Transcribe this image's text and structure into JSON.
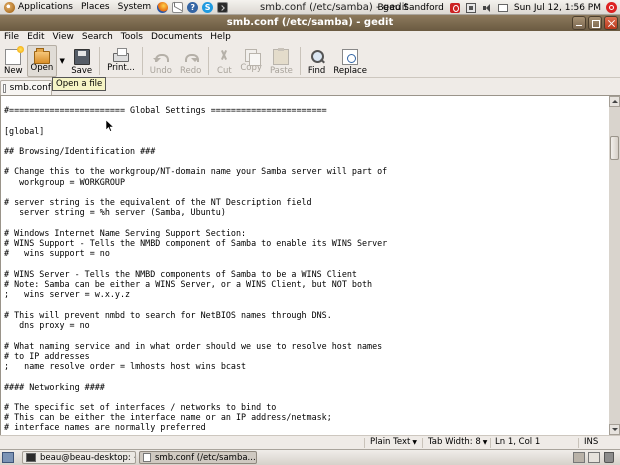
{
  "top_panel": {
    "menus": [
      "Applications",
      "Places",
      "System"
    ],
    "launchers": [
      "firefox-icon",
      "mail-icon",
      "help-icon",
      "skype-icon",
      "terminal-icon"
    ],
    "help_glyph": "?",
    "skype_glyph": "S",
    "user": "Beau Sandford",
    "clock": "Sun Jul 12,  1:56 PM",
    "tray_icons": [
      "network-icon",
      "volume-icon",
      "mail-indicator-icon"
    ]
  },
  "window": {
    "title": "smb.conf (/etc/samba) - gedit",
    "buttons": [
      "minimize",
      "maximize",
      "close"
    ]
  },
  "menubar": [
    "File",
    "Edit",
    "View",
    "Search",
    "Tools",
    "Documents",
    "Help"
  ],
  "toolbar": {
    "new": "New",
    "open": "Open",
    "save": "Save",
    "print": "Print...",
    "undo": "Undo",
    "redo": "Redo",
    "cut": "Cut",
    "copy": "Copy",
    "paste": "Paste",
    "find": "Find",
    "replace": "Replace",
    "open_arrow": "▼"
  },
  "tooltip": "Open a file",
  "tab": {
    "label": "smb.conf"
  },
  "editor": {
    "lines": [
      "#======================= Global Settings =======================",
      "",
      "[global]",
      "",
      "## Browsing/Identification ###",
      "",
      "# Change this to the workgroup/NT-domain name your Samba server will part of",
      "   workgroup = WORKGROUP",
      "",
      "# server string is the equivalent of the NT Description field",
      "   server string = %h server (Samba, Ubuntu)",
      "",
      "# Windows Internet Name Serving Support Section:",
      "# WINS Support - Tells the NMBD component of Samba to enable its WINS Server",
      "#   wins support = no",
      "",
      "# WINS Server - Tells the NMBD components of Samba to be a WINS Client",
      "# Note: Samba can be either a WINS Server, or a WINS Client, but NOT both",
      ";   wins server = w.x.y.z",
      "",
      "# This will prevent nmbd to search for NetBIOS names through DNS.",
      "   dns proxy = no",
      "",
      "# What naming service and in what order should we use to resolve host names",
      "# to IP addresses",
      ";   name resolve order = lmhosts host wins bcast",
      "",
      "#### Networking ####",
      "",
      "# The specific set of interfaces / networks to bind to",
      "# This can be either the interface name or an IP address/netmask;",
      "# interface names are normally preferred"
    ]
  },
  "statusbar": {
    "syntax": "Plain Text",
    "tab_width": "Tab Width:  8",
    "position": "Ln 1, Col 1",
    "mode": "INS",
    "combo_arrow": "▼"
  },
  "bottom_panel": {
    "tasks": [
      {
        "label": "beau@beau-desktop: ~",
        "icon": "terminal-icon"
      },
      {
        "label": "smb.conf (/etc/samba...",
        "icon": "document-icon"
      }
    ]
  }
}
